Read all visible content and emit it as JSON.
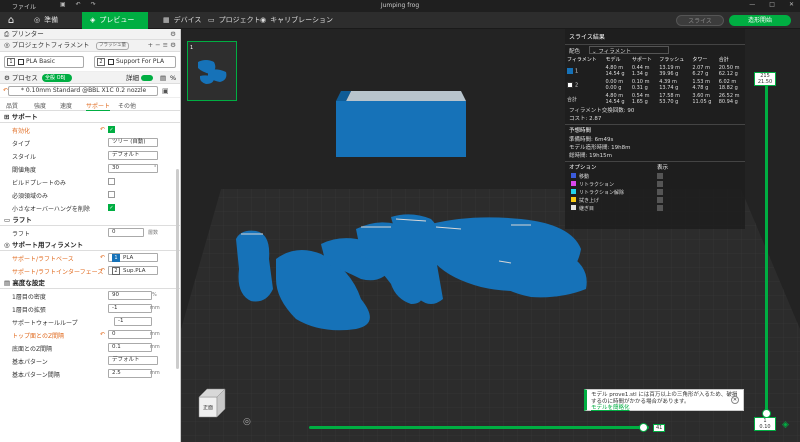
{
  "titlebar": {
    "menu": "ファイル",
    "title": "Jumping frog"
  },
  "toolbar": {
    "tabs": [
      {
        "label": "準備",
        "icon": "target-icon"
      },
      {
        "label": "プレビュー",
        "icon": "cube-icon"
      },
      {
        "label": "デバイス",
        "icon": "grid-icon"
      },
      {
        "label": "プロジェクト",
        "icon": "folder-icon"
      },
      {
        "label": "キャリブレーション",
        "icon": "calibration-icon"
      }
    ],
    "slice_label": "スライス",
    "print_label": "造形開始"
  },
  "printer": {
    "label": "プリンター"
  },
  "filament": {
    "label": "プロジェクトフィラメント",
    "flush_btn": "フラッシュ量",
    "slot1": {
      "num": "1",
      "name": "PLA Basic"
    },
    "slot2": {
      "num": "2",
      "name": "Support For PLA"
    }
  },
  "process": {
    "label": "プロセス",
    "toggle_all": "全般",
    "toggle_obj": "OBJ",
    "detail": "詳細",
    "preset": "* 0.10mm Standard @BBL X1C 0.2 nozzle",
    "tabs": [
      "品質",
      "強度",
      "速度",
      "サポート",
      "その他"
    ]
  },
  "support": {
    "title": "サポート",
    "enable": "有効化",
    "type_label": "タイプ",
    "type_val": "ツリー (自動)",
    "style_label": "スタイル",
    "style_val": "デフォルト",
    "threshold_label": "閾値角度",
    "threshold_val": "30",
    "threshold_unit": "°",
    "buildplate_only": "ビルドプレートのみ",
    "enforcers_only": "必須領域のみ",
    "remove_small": "小さなオーバーハングを削除"
  },
  "raft": {
    "title": "ラフト",
    "layers_label": "ラフト",
    "layers_val": "0",
    "layers_unit": "層数"
  },
  "support_filament": {
    "title": "サポート用フィラメント",
    "base_label": "サポート/ラフトベース",
    "base_num": "1",
    "base_val": "PLA",
    "iface_label": "サポート/ラフトインターフェース",
    "iface_num": "2",
    "iface_val": "Sup.PLA"
  },
  "advanced": {
    "title": "高度な設定",
    "rows": [
      {
        "label": "1層目の密度",
        "val": "90",
        "unit": "%"
      },
      {
        "label": "1層目の拡張",
        "val": "-1",
        "unit": "mm"
      },
      {
        "label": "サポートウォールループ",
        "val": "-1",
        "unit": ""
      },
      {
        "label": "トップ面とのZ間隔",
        "val": "0",
        "unit": "mm"
      },
      {
        "label": "底面とのZ間隔",
        "val": "0.1",
        "unit": "mm"
      },
      {
        "label": "基本パターン",
        "val": "デフォルト",
        "unit": ""
      },
      {
        "label": "基本パターン間隔",
        "val": "2.5",
        "unit": "mm"
      }
    ]
  },
  "stats": {
    "title": "スライス結果",
    "color_label": "配色",
    "color_val": "フィラメント",
    "headers": [
      "フィラメント",
      "モデル",
      "サポート",
      "フラッシュ",
      "タワー",
      "合計"
    ],
    "rows": [
      {
        "id": "1",
        "model": "4.80 m\n14.54 g",
        "support": "0.44 m\n1.34 g",
        "flush": "13.19 m\n39.96 g",
        "tower": "2.07 m\n6.27 g",
        "total": "20.50 m\n62.12 g"
      },
      {
        "id": "2",
        "model": "0.00 m\n0.00 g",
        "support": "0.10 m\n0.31 g",
        "flush": "4.39 m\n13.74 g",
        "tower": "1.53 m\n4.78 g",
        "total": "6.02 m\n18.82 g"
      }
    ],
    "total_row": {
      "label": "合計",
      "model": "4.80 m\n14.54 g",
      "support": "0.54 m\n1.65 g",
      "flush": "17.58 m\n53.70 g",
      "tower": "3.60 m\n11.05 g",
      "total": "26.52 m\n80.94 g"
    },
    "change_label": "フィラメント交換回数:",
    "change_val": "90",
    "cost_label": "コスト:",
    "cost_val": "2.87",
    "time_title": "予想時間",
    "prep_label": "準備時間:",
    "prep_val": "6m49s",
    "model_time_label": "モデル造形時間:",
    "model_time_val": "19h8m",
    "total_time_label": "総時間:",
    "total_time_val": "19h15m",
    "options_title": "オプション",
    "display_label": "表示",
    "options": [
      {
        "label": "移動",
        "color": "#3b5bdb"
      },
      {
        "label": "リトラクション",
        "color": "#d946ef"
      },
      {
        "label": "リトラクション解除",
        "color": "#22d3ee"
      },
      {
        "label": "拭き上げ",
        "color": "#facc15"
      },
      {
        "label": "継ぎ目",
        "color": "#e5e5e5"
      }
    ]
  },
  "vslider": {
    "top_a": "215",
    "top_b": "21.50",
    "bot_a": "1",
    "bot_b": "0.10"
  },
  "hslider": {
    "val": "41"
  },
  "notice": {
    "text": "モデル prove1.stl には百万以上の三角形が入るため、破損するのに時間がかかる場合があります。",
    "link": "モデルを簡略化"
  },
  "cube": {
    "label": "正面"
  },
  "colors": {
    "accent": "#00ae42",
    "model": "#1672b8"
  }
}
